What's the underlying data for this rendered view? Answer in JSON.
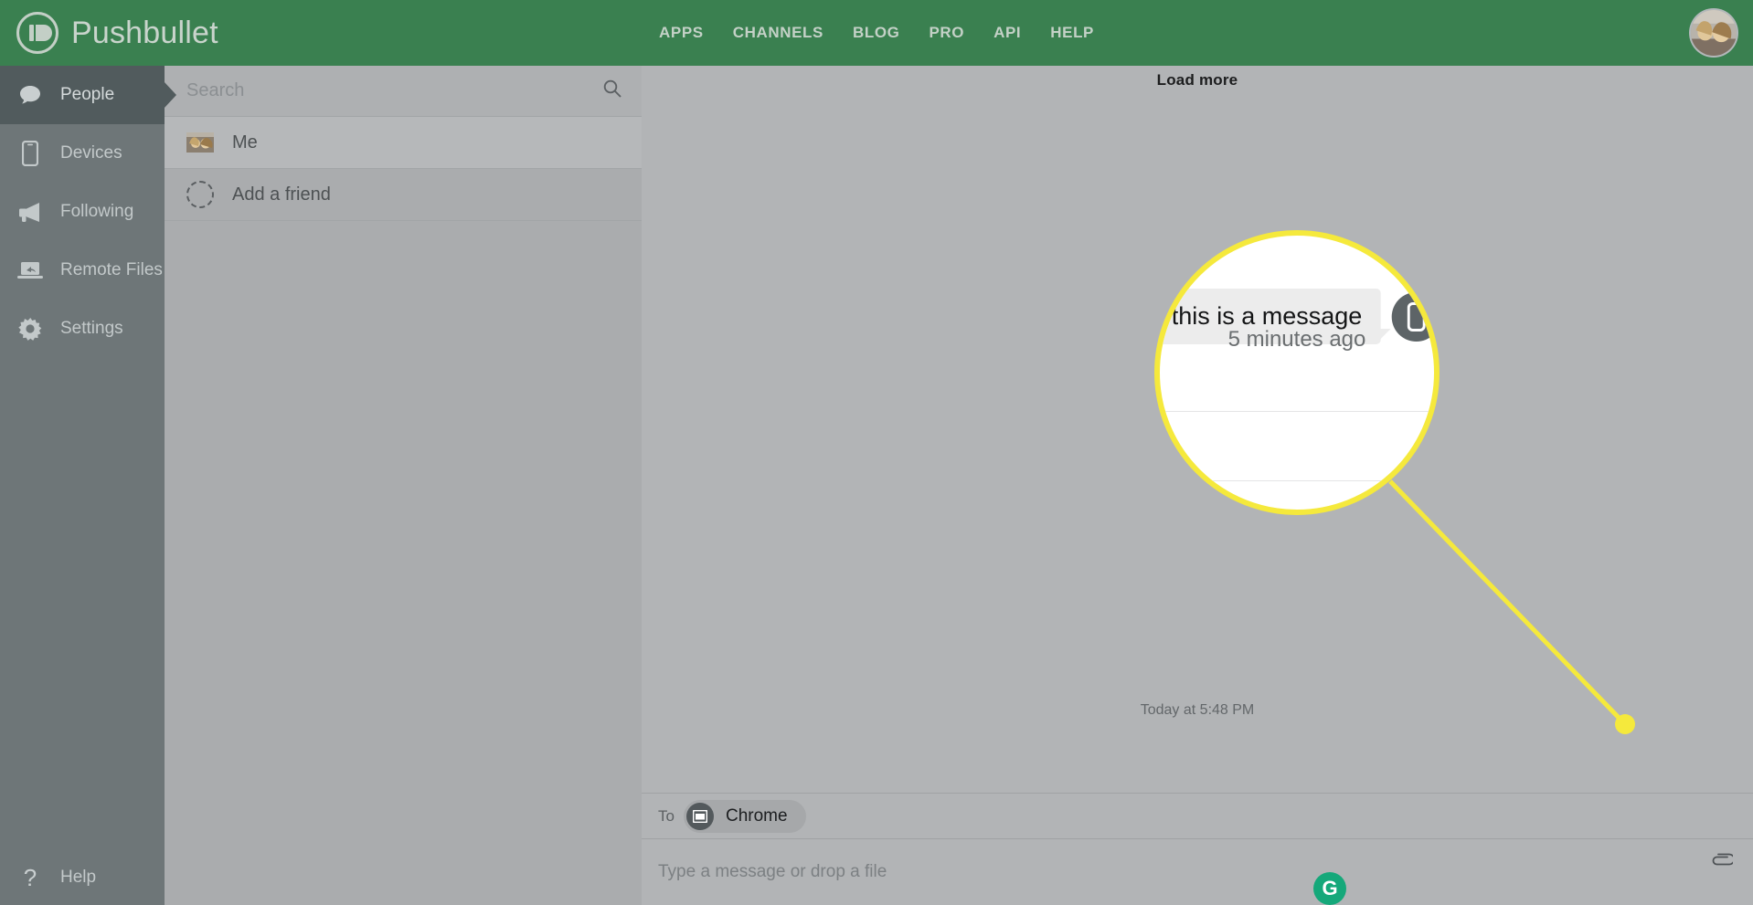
{
  "topbar": {
    "brand": "Pushbullet",
    "brand_logo_icon": "pushbullet-logo-icon",
    "nav": [
      {
        "label": "APPS"
      },
      {
        "label": "CHANNELS"
      },
      {
        "label": "BLOG"
      },
      {
        "label": "PRO"
      },
      {
        "label": "API"
      },
      {
        "label": "HELP"
      }
    ],
    "avatar_icon": "user-avatar",
    "accent_green": "#3a8050"
  },
  "sidebar": {
    "items": [
      {
        "label": "People",
        "icon": "chat-bubble-icon",
        "active": true
      },
      {
        "label": "Devices",
        "icon": "phone-icon",
        "active": false
      },
      {
        "label": "Following",
        "icon": "megaphone-icon",
        "active": false
      },
      {
        "label": "Remote Files",
        "icon": "laptop-share-icon",
        "active": false
      },
      {
        "label": "Settings",
        "icon": "gear-icon",
        "active": false
      }
    ],
    "help": {
      "label": "Help",
      "icon": "question-mark-icon"
    },
    "bg_color": "#6e7678",
    "active_bg_color": "#515b5d"
  },
  "contacts": {
    "search": {
      "value": "",
      "placeholder": "Search",
      "icon": "search-icon"
    },
    "rows": [
      {
        "label": "Me",
        "icon": "contact-photo",
        "selected": true
      },
      {
        "label": "Add a friend",
        "icon": "dashed-circle-icon",
        "selected": false
      }
    ],
    "bg_color": "#aaacae"
  },
  "chat": {
    "load_more": "Load more",
    "day_stamp": "Today at 5:48 PM",
    "message": {
      "text": "this is a message",
      "time": "5 minutes ago",
      "device_icon": "phone-icon"
    }
  },
  "callout": {
    "message_text": "this is a message",
    "message_time": "5 minutes ago",
    "device_icon": "phone-icon",
    "highlight_color": "#f5e93c"
  },
  "composer": {
    "to_label": "To",
    "chip": {
      "label": "Chrome",
      "icon": "browser-window-icon"
    },
    "input": {
      "value": "",
      "placeholder": "Type a message or drop a file"
    },
    "grammarly_icon": "grammarly-icon",
    "grammarly_letter": "G",
    "attach_icon": "paperclip-icon"
  }
}
